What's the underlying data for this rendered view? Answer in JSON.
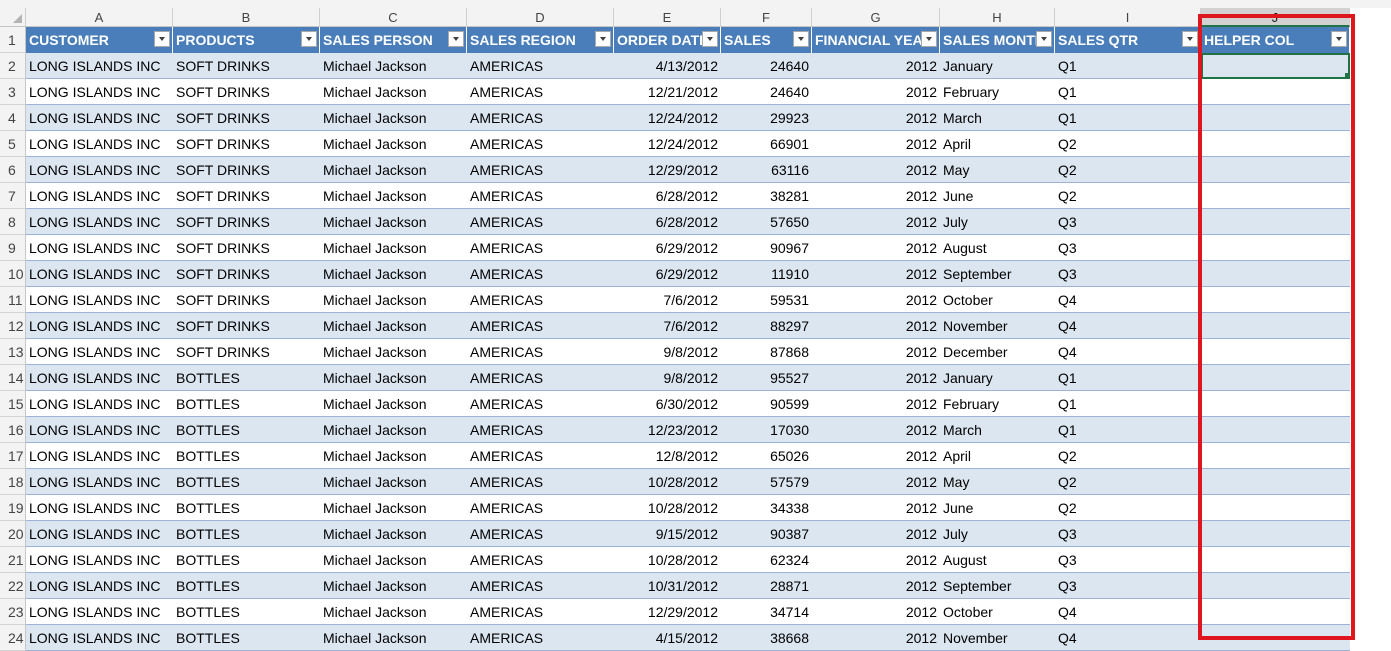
{
  "column_letters": [
    "A",
    "B",
    "C",
    "D",
    "E",
    "F",
    "G",
    "H",
    "I",
    "J"
  ],
  "headers": [
    "CUSTOMER",
    "PRODUCTS",
    "SALES PERSON",
    "SALES REGION",
    "ORDER DATE",
    "SALES",
    "FINANCIAL YEAR",
    "SALES MONTH",
    "SALES QTR",
    "HELPER COL"
  ],
  "row_numbers": [
    "1",
    "2",
    "3",
    "4",
    "5",
    "6",
    "7",
    "8",
    "9",
    "10",
    "11",
    "12",
    "13",
    "14",
    "15",
    "16",
    "17",
    "18",
    "19",
    "20",
    "21",
    "22",
    "23",
    "24"
  ],
  "rows": [
    {
      "customer": "LONG ISLANDS INC",
      "product": "SOFT DRINKS",
      "person": "Michael Jackson",
      "region": "AMERICAS",
      "date": "4/13/2012",
      "sales": "24640",
      "year": "2012",
      "month": "January",
      "qtr": "Q1",
      "helper": ""
    },
    {
      "customer": "LONG ISLANDS INC",
      "product": "SOFT DRINKS",
      "person": "Michael Jackson",
      "region": "AMERICAS",
      "date": "12/21/2012",
      "sales": "24640",
      "year": "2012",
      "month": "February",
      "qtr": "Q1",
      "helper": ""
    },
    {
      "customer": "LONG ISLANDS INC",
      "product": "SOFT DRINKS",
      "person": "Michael Jackson",
      "region": "AMERICAS",
      "date": "12/24/2012",
      "sales": "29923",
      "year": "2012",
      "month": "March",
      "qtr": "Q1",
      "helper": ""
    },
    {
      "customer": "LONG ISLANDS INC",
      "product": "SOFT DRINKS",
      "person": "Michael Jackson",
      "region": "AMERICAS",
      "date": "12/24/2012",
      "sales": "66901",
      "year": "2012",
      "month": "April",
      "qtr": "Q2",
      "helper": ""
    },
    {
      "customer": "LONG ISLANDS INC",
      "product": "SOFT DRINKS",
      "person": "Michael Jackson",
      "region": "AMERICAS",
      "date": "12/29/2012",
      "sales": "63116",
      "year": "2012",
      "month": "May",
      "qtr": "Q2",
      "helper": ""
    },
    {
      "customer": "LONG ISLANDS INC",
      "product": "SOFT DRINKS",
      "person": "Michael Jackson",
      "region": "AMERICAS",
      "date": "6/28/2012",
      "sales": "38281",
      "year": "2012",
      "month": "June",
      "qtr": "Q2",
      "helper": ""
    },
    {
      "customer": "LONG ISLANDS INC",
      "product": "SOFT DRINKS",
      "person": "Michael Jackson",
      "region": "AMERICAS",
      "date": "6/28/2012",
      "sales": "57650",
      "year": "2012",
      "month": "July",
      "qtr": "Q3",
      "helper": ""
    },
    {
      "customer": "LONG ISLANDS INC",
      "product": "SOFT DRINKS",
      "person": "Michael Jackson",
      "region": "AMERICAS",
      "date": "6/29/2012",
      "sales": "90967",
      "year": "2012",
      "month": "August",
      "qtr": "Q3",
      "helper": ""
    },
    {
      "customer": "LONG ISLANDS INC",
      "product": "SOFT DRINKS",
      "person": "Michael Jackson",
      "region": "AMERICAS",
      "date": "6/29/2012",
      "sales": "11910",
      "year": "2012",
      "month": "September",
      "qtr": "Q3",
      "helper": ""
    },
    {
      "customer": "LONG ISLANDS INC",
      "product": "SOFT DRINKS",
      "person": "Michael Jackson",
      "region": "AMERICAS",
      "date": "7/6/2012",
      "sales": "59531",
      "year": "2012",
      "month": "October",
      "qtr": "Q4",
      "helper": ""
    },
    {
      "customer": "LONG ISLANDS INC",
      "product": "SOFT DRINKS",
      "person": "Michael Jackson",
      "region": "AMERICAS",
      "date": "7/6/2012",
      "sales": "88297",
      "year": "2012",
      "month": "November",
      "qtr": "Q4",
      "helper": ""
    },
    {
      "customer": "LONG ISLANDS INC",
      "product": "SOFT DRINKS",
      "person": "Michael Jackson",
      "region": "AMERICAS",
      "date": "9/8/2012",
      "sales": "87868",
      "year": "2012",
      "month": "December",
      "qtr": "Q4",
      "helper": ""
    },
    {
      "customer": "LONG ISLANDS INC",
      "product": "BOTTLES",
      "person": "Michael Jackson",
      "region": "AMERICAS",
      "date": "9/8/2012",
      "sales": "95527",
      "year": "2012",
      "month": "January",
      "qtr": "Q1",
      "helper": ""
    },
    {
      "customer": "LONG ISLANDS INC",
      "product": "BOTTLES",
      "person": "Michael Jackson",
      "region": "AMERICAS",
      "date": "6/30/2012",
      "sales": "90599",
      "year": "2012",
      "month": "February",
      "qtr": "Q1",
      "helper": ""
    },
    {
      "customer": "LONG ISLANDS INC",
      "product": "BOTTLES",
      "person": "Michael Jackson",
      "region": "AMERICAS",
      "date": "12/23/2012",
      "sales": "17030",
      "year": "2012",
      "month": "March",
      "qtr": "Q1",
      "helper": ""
    },
    {
      "customer": "LONG ISLANDS INC",
      "product": "BOTTLES",
      "person": "Michael Jackson",
      "region": "AMERICAS",
      "date": "12/8/2012",
      "sales": "65026",
      "year": "2012",
      "month": "April",
      "qtr": "Q2",
      "helper": ""
    },
    {
      "customer": "LONG ISLANDS INC",
      "product": "BOTTLES",
      "person": "Michael Jackson",
      "region": "AMERICAS",
      "date": "10/28/2012",
      "sales": "57579",
      "year": "2012",
      "month": "May",
      "qtr": "Q2",
      "helper": ""
    },
    {
      "customer": "LONG ISLANDS INC",
      "product": "BOTTLES",
      "person": "Michael Jackson",
      "region": "AMERICAS",
      "date": "10/28/2012",
      "sales": "34338",
      "year": "2012",
      "month": "June",
      "qtr": "Q2",
      "helper": ""
    },
    {
      "customer": "LONG ISLANDS INC",
      "product": "BOTTLES",
      "person": "Michael Jackson",
      "region": "AMERICAS",
      "date": "9/15/2012",
      "sales": "90387",
      "year": "2012",
      "month": "July",
      "qtr": "Q3",
      "helper": ""
    },
    {
      "customer": "LONG ISLANDS INC",
      "product": "BOTTLES",
      "person": "Michael Jackson",
      "region": "AMERICAS",
      "date": "10/28/2012",
      "sales": "62324",
      "year": "2012",
      "month": "August",
      "qtr": "Q3",
      "helper": ""
    },
    {
      "customer": "LONG ISLANDS INC",
      "product": "BOTTLES",
      "person": "Michael Jackson",
      "region": "AMERICAS",
      "date": "10/31/2012",
      "sales": "28871",
      "year": "2012",
      "month": "September",
      "qtr": "Q3",
      "helper": ""
    },
    {
      "customer": "LONG ISLANDS INC",
      "product": "BOTTLES",
      "person": "Michael Jackson",
      "region": "AMERICAS",
      "date": "12/29/2012",
      "sales": "34714",
      "year": "2012",
      "month": "October",
      "qtr": "Q4",
      "helper": ""
    },
    {
      "customer": "LONG ISLANDS INC",
      "product": "BOTTLES",
      "person": "Michael Jackson",
      "region": "AMERICAS",
      "date": "4/15/2012",
      "sales": "38668",
      "year": "2012",
      "month": "November",
      "qtr": "Q4",
      "helper": ""
    }
  ],
  "selected_cell": "J2",
  "selected_column": "J",
  "colors": {
    "header_fill": "#4a7ebb",
    "band_fill": "#dce6f1",
    "highlight_border": "#e0161e",
    "selection": "#217346"
  }
}
